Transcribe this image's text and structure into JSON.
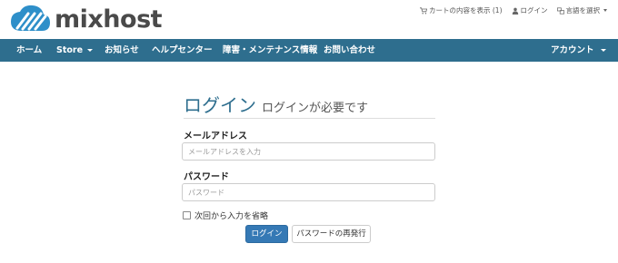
{
  "brand": {
    "name": "mixhost"
  },
  "top_links": {
    "cart": "カートの内容を表示 (1)",
    "login": "ログイン",
    "language": "言語を選択"
  },
  "nav": {
    "home": "ホーム",
    "store": "Store",
    "news": "お知らせ",
    "help": "ヘルプセンター",
    "maintenance": "障害・メンテナンス情報",
    "contact": "お問い合わせ",
    "account": "アカウント"
  },
  "login": {
    "title": "ログイン",
    "subtitle": "ログインが必要です",
    "email_label": "メールアドレス",
    "email_placeholder": "メールアドレスを入力",
    "password_label": "パスワード",
    "password_placeholder": "パスワード",
    "remember_label": "次回から入力を省略",
    "submit_label": "ログイン",
    "reset_label": "パスワードの再発行"
  },
  "colors": {
    "nav_bg": "#2e6e8e",
    "primary": "#3579b5",
    "logo_blue": "#2e8fc9"
  }
}
